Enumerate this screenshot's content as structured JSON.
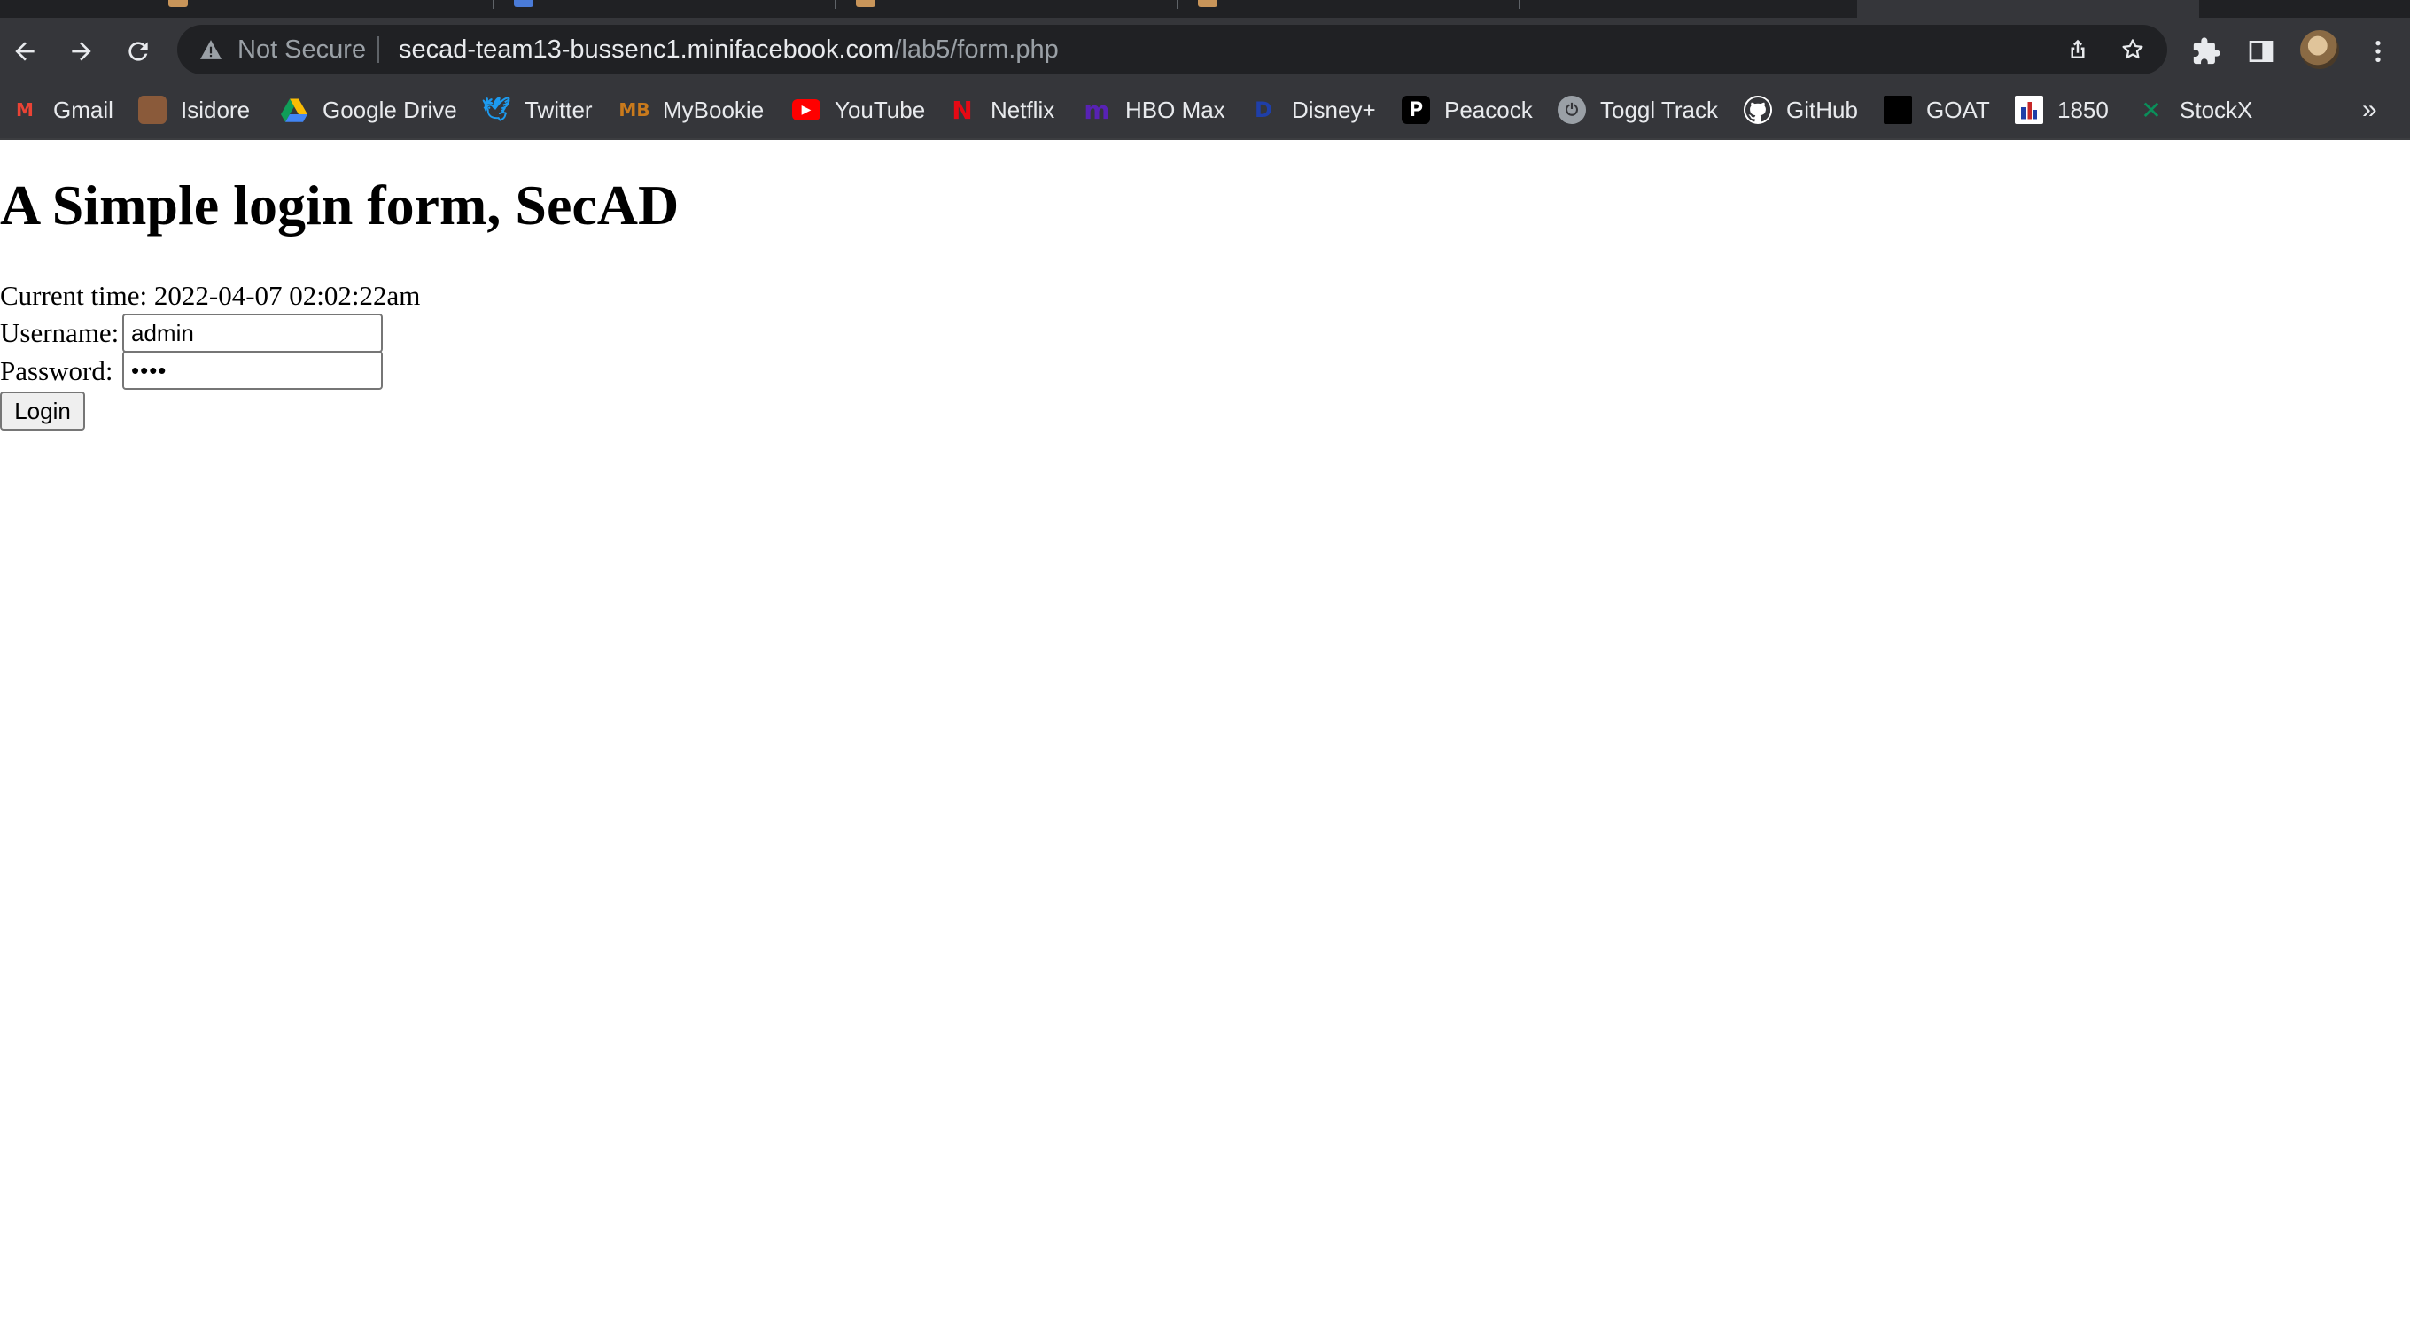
{
  "browser": {
    "security_label": "Not Secure",
    "url_host": "secad-team13-bussenc1.minifacebook.com",
    "url_path": "/lab5/form.php",
    "bookmarks": [
      {
        "label": "Gmail",
        "icon": "gmail-icon",
        "color": "#ea4335"
      },
      {
        "label": "Isidore",
        "icon": "isidore-icon",
        "color": "#8a5a3a"
      },
      {
        "label": "Google Drive",
        "icon": "google-drive-icon",
        "color": "#fbbc04"
      },
      {
        "label": "Twitter",
        "icon": "twitter-icon",
        "color": "#1d9bf0"
      },
      {
        "label": "MyBookie",
        "icon": "mybookie-icon",
        "color": "#c97a1c"
      },
      {
        "label": "YouTube",
        "icon": "youtube-icon",
        "color": "#ff0000"
      },
      {
        "label": "Netflix",
        "icon": "netflix-icon",
        "color": "#e50914"
      },
      {
        "label": "HBO Max",
        "icon": "hbo-max-icon",
        "color": "#5822b4"
      },
      {
        "label": "Disney+",
        "icon": "disney-plus-icon",
        "color": "#1f3fa8"
      },
      {
        "label": "Peacock",
        "icon": "peacock-icon",
        "color": "#000000"
      },
      {
        "label": "Toggl Track",
        "icon": "toggl-track-icon",
        "color": "#9aa0a6"
      },
      {
        "label": "GitHub",
        "icon": "github-icon",
        "color": "#ffffff"
      },
      {
        "label": "GOAT",
        "icon": "goat-icon",
        "color": "#000000"
      },
      {
        "label": "1850",
        "icon": "1850-icon",
        "color": "#ffffff"
      },
      {
        "label": "StockX",
        "icon": "stockx-icon",
        "color": "#006340"
      }
    ],
    "more_bookmarks": "»"
  },
  "page": {
    "title": "A Simple login form, SecAD",
    "time_label": "Current time: ",
    "time_value": "2022-04-07 02:02:22am",
    "username_label": "Username:",
    "username_value": "admin",
    "password_label": "Password:",
    "password_value": "••••",
    "login_label": "Login"
  }
}
